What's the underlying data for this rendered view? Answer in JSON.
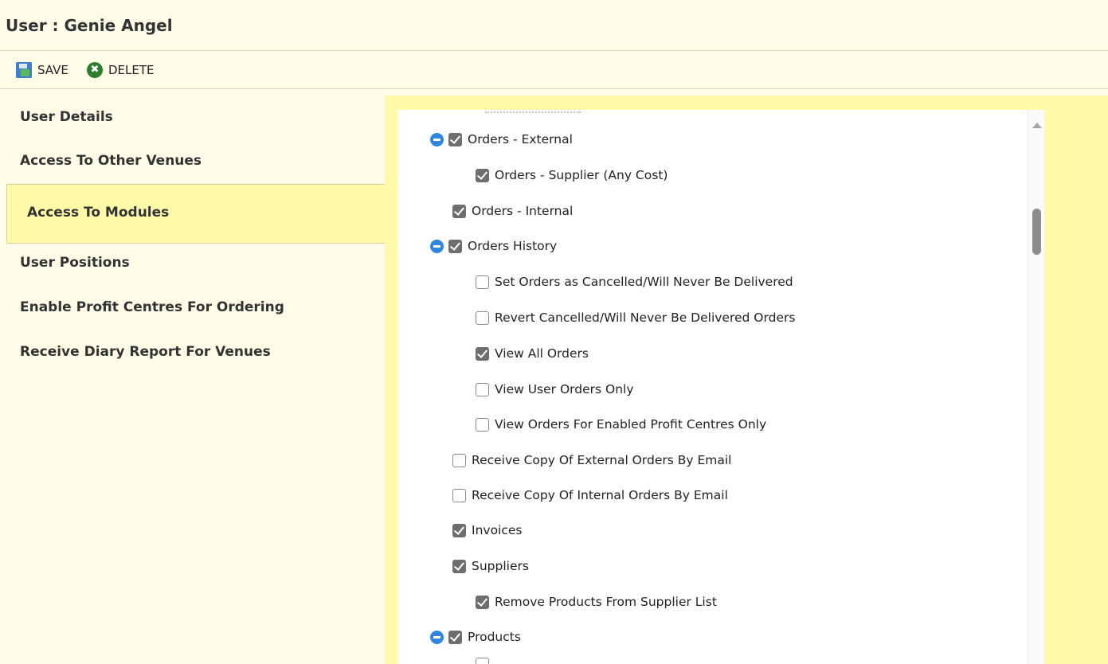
{
  "header": {
    "title": "User : Genie Angel"
  },
  "toolbar": {
    "save_label": "SAVE",
    "delete_label": "DELETE",
    "delete_icon_glyph": "✖"
  },
  "sidebar": {
    "items": [
      {
        "label": "User Details",
        "active": false
      },
      {
        "label": "Access To Other Venues",
        "active": false
      },
      {
        "label": "Access To Modules",
        "active": true
      },
      {
        "label": "User Positions",
        "active": false
      },
      {
        "label": "Enable Profit Centres For Ordering",
        "active": false
      },
      {
        "label": "Receive Diary Report For Venues",
        "active": false
      }
    ]
  },
  "modules": [
    {
      "label": "Orders - External",
      "checked": true,
      "level": 1,
      "collapsible": true
    },
    {
      "label": "Orders - Supplier (Any Cost)",
      "checked": true,
      "level": 2,
      "collapsible": false
    },
    {
      "label": "Orders - Internal",
      "checked": true,
      "level": 1,
      "collapsible": false
    },
    {
      "label": "Orders History",
      "checked": true,
      "level": 1,
      "collapsible": true
    },
    {
      "label": "Set Orders as Cancelled/Will Never Be Delivered",
      "checked": false,
      "level": 2,
      "collapsible": false
    },
    {
      "label": "Revert Cancelled/Will Never Be Delivered Orders",
      "checked": false,
      "level": 2,
      "collapsible": false
    },
    {
      "label": "View All Orders",
      "checked": true,
      "level": 2,
      "collapsible": false
    },
    {
      "label": "View User Orders Only",
      "checked": false,
      "level": 2,
      "collapsible": false
    },
    {
      "label": "View Orders For Enabled Profit Centres Only",
      "checked": false,
      "level": 2,
      "collapsible": false
    },
    {
      "label": "Receive Copy Of External Orders By Email",
      "checked": false,
      "level": 1,
      "collapsible": false
    },
    {
      "label": "Receive Copy Of Internal Orders By Email",
      "checked": false,
      "level": 1,
      "collapsible": false
    },
    {
      "label": "Invoices",
      "checked": true,
      "level": 1,
      "collapsible": false
    },
    {
      "label": "Suppliers",
      "checked": true,
      "level": 1,
      "collapsible": false
    },
    {
      "label": "Remove Products From Supplier List",
      "checked": true,
      "level": 2,
      "collapsible": false
    },
    {
      "label": "Products",
      "checked": true,
      "level": 1,
      "collapsible": true
    }
  ],
  "colors": {
    "accent": "#fffaa8",
    "toggle": "#2e86de",
    "checked": "#6e6e6e",
    "background": "#fffde8"
  }
}
